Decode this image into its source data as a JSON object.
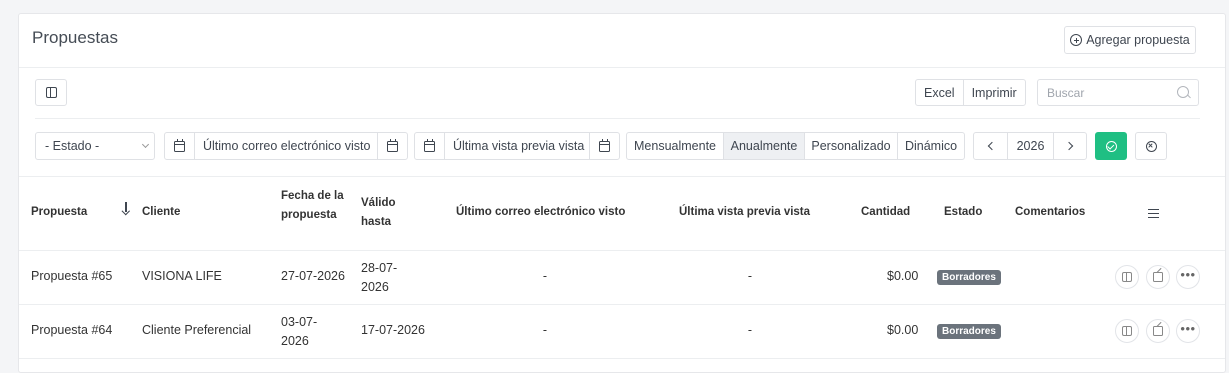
{
  "header": {
    "title": "Propuestas",
    "add_button": "Agregar propuesta"
  },
  "toolbar": {
    "export_buttons": [
      "Excel",
      "Imprimir"
    ],
    "search_placeholder": "Buscar"
  },
  "filters": {
    "status_select": "- Estado -",
    "last_email_seen": "Último correo electrónico visto",
    "last_preview_seen": "Última vista previa vista",
    "period_options": [
      "Mensualmente",
      "Anualmente",
      "Personalizado",
      "Dinámico"
    ],
    "active_period": "Anualmente",
    "year": "2026"
  },
  "table": {
    "columns": {
      "proposal": "Propuesta",
      "client": "Cliente",
      "proposal_date": "Fecha de la propuesta",
      "valid_until": "Válido hasta",
      "last_email": "Último correo electrónico visto",
      "last_preview": "Última vista previa vista",
      "amount": "Cantidad",
      "status": "Estado",
      "comments": "Comentarios"
    },
    "rows": [
      {
        "proposal": "Propuesta #65",
        "client": "VISIONA LIFE",
        "proposal_date": "27-07-2026",
        "valid_until": "28-07-2026",
        "last_email": "-",
        "last_preview": "-",
        "amount": "$0.00",
        "status": "Borradores"
      },
      {
        "proposal": "Propuesta #64",
        "client": "Cliente Preferencial",
        "proposal_date": "03-07-2026",
        "valid_until": "17-07-2026",
        "last_email": "-",
        "last_preview": "-",
        "amount": "$0.00",
        "status": "Borradores"
      }
    ]
  }
}
